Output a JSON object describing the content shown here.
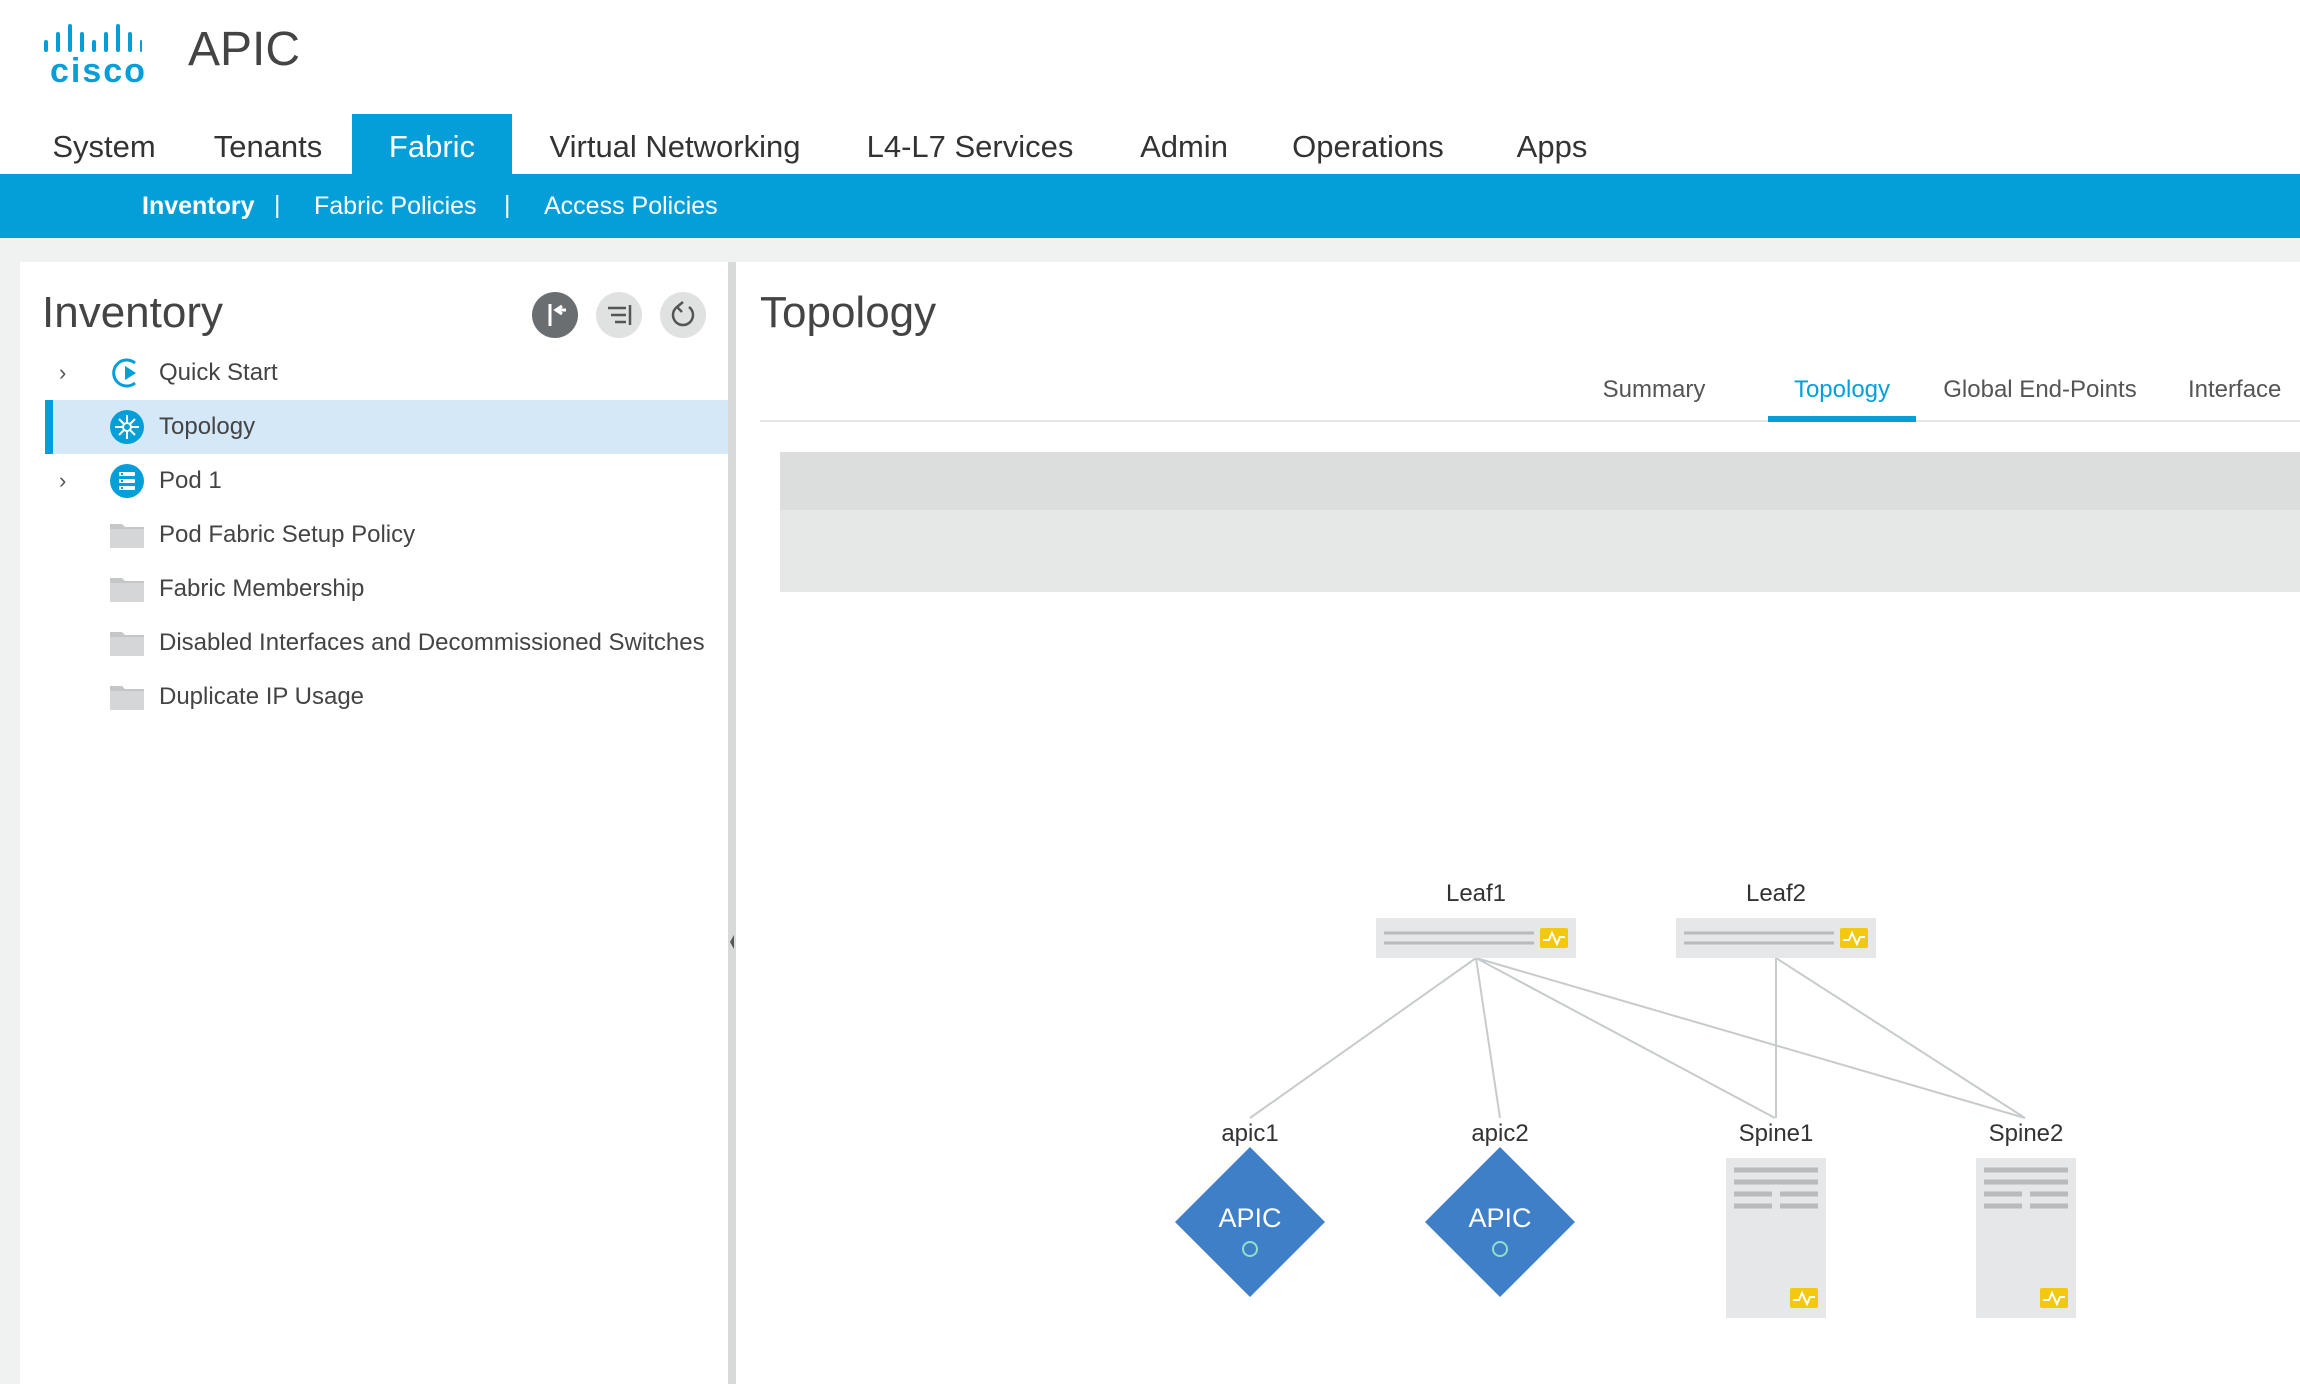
{
  "header": {
    "logo_text": "cisco",
    "app_title": "APIC"
  },
  "main_tabs": [
    {
      "label": "System"
    },
    {
      "label": "Tenants"
    },
    {
      "label": "Fabric"
    },
    {
      "label": "Virtual Networking"
    },
    {
      "label": "L4-L7 Services"
    },
    {
      "label": "Admin"
    },
    {
      "label": "Operations"
    },
    {
      "label": "Apps"
    }
  ],
  "active_main_tab": "Fabric",
  "subnav": {
    "items": [
      {
        "label": "Inventory"
      },
      {
        "label": "Fabric Policies"
      },
      {
        "label": "Access Policies"
      }
    ],
    "separator": "|"
  },
  "left_panel": {
    "title": "Inventory",
    "tree": [
      {
        "label": "Quick Start",
        "icon": "quick-start-icon",
        "expandable": true
      },
      {
        "label": "Topology",
        "icon": "topology-icon",
        "selected": true
      },
      {
        "label": "Pod 1",
        "icon": "pod-icon",
        "expandable": true
      },
      {
        "label": "Pod Fabric Setup Policy",
        "icon": "folder-icon"
      },
      {
        "label": "Fabric Membership",
        "icon": "folder-icon"
      },
      {
        "label": "Disabled Interfaces and Decommissioned Switches",
        "icon": "folder-icon"
      },
      {
        "label": "Duplicate IP Usage",
        "icon": "folder-icon"
      }
    ],
    "expand_glyph": "›"
  },
  "right_panel": {
    "title": "Topology",
    "tabs": [
      {
        "label": "Summary"
      },
      {
        "label": "Topology"
      },
      {
        "label": "Global End-Points"
      },
      {
        "label": "Interface"
      }
    ],
    "active_tab": "Topology"
  },
  "topology": {
    "leafs": [
      {
        "name": "Leaf1"
      },
      {
        "name": "Leaf2"
      }
    ],
    "controllers": [
      {
        "name": "apic1",
        "badge": "APIC"
      },
      {
        "name": "apic2",
        "badge": "APIC"
      }
    ],
    "spines": [
      {
        "name": "Spine1"
      },
      {
        "name": "Spine2"
      }
    ]
  },
  "colors": {
    "accent": "#049fd9",
    "apic_node": "#3f7fc7",
    "health_yellow": "#f2c811",
    "link": "#c8cbcd"
  }
}
